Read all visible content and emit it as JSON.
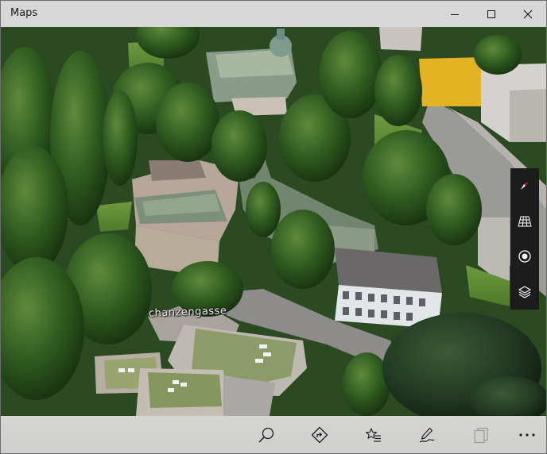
{
  "window": {
    "title": "Maps",
    "controls": [
      "minimize",
      "maximize",
      "close"
    ]
  },
  "map": {
    "view": "3D aerial",
    "street_label": "chanzengasse"
  },
  "map_controls": [
    {
      "name": "compass-icon"
    },
    {
      "name": "3d-cities-icon"
    },
    {
      "name": "show-my-location-icon"
    },
    {
      "name": "map-layers-icon"
    }
  ],
  "bottom_toolbar": [
    {
      "name": "search-icon"
    },
    {
      "name": "directions-icon"
    },
    {
      "name": "favorites-icon"
    },
    {
      "name": "ink-icon"
    },
    {
      "name": "collections-icon"
    },
    {
      "name": "more-icon"
    }
  ],
  "colors": {
    "title_bar": "#d7d7d7",
    "bottom_bar": "#d2d3d0",
    "map_controls_bg": "#1c1c1c",
    "compass_needle": "#e81123"
  }
}
